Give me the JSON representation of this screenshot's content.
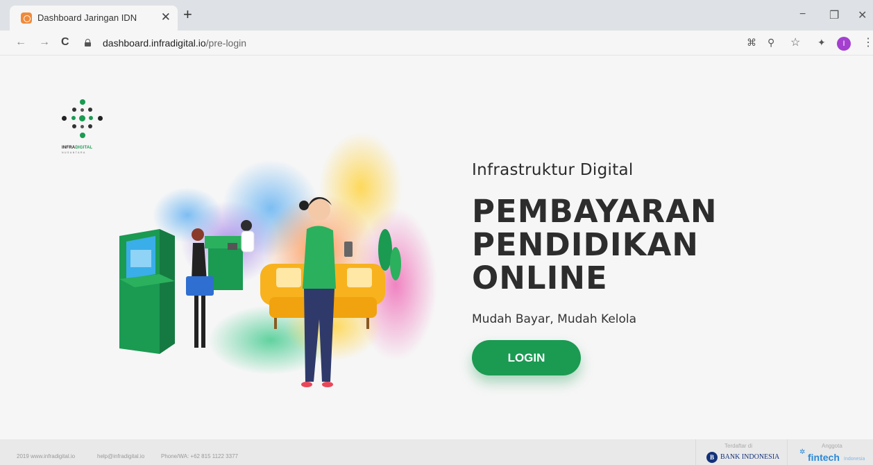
{
  "browser": {
    "tab_title": "Dashboard Jaringan IDN",
    "tab_close": "✕",
    "new_tab": "+",
    "url_host": "dashboard.infradigital.io",
    "url_path": "/pre-login",
    "profile_initial": "I",
    "window_controls": {
      "minimize": "−",
      "restore": "❐",
      "close": "✕"
    },
    "nav": {
      "back": "←",
      "forward": "→",
      "reload": "C"
    },
    "toolbar_icons": {
      "qr": "⌘",
      "zoom": "⚲",
      "star": "☆",
      "extensions": "✦",
      "menu": "⋮"
    }
  },
  "logo": {
    "word_infra": "INFRA",
    "word_digital": "DIGITAL",
    "subtitle": "NUSANTARA"
  },
  "hero": {
    "subtitle": "Infrastruktur Digital",
    "title_lines": [
      "PEMBAYARAN",
      "PENDIDIKAN",
      "ONLINE"
    ],
    "tagline": "Mudah Bayar, Mudah Kelola",
    "login_label": "LOGIN"
  },
  "footer": {
    "site": "2019 www.infradigital.io",
    "email": "help@infradigital.io",
    "phone": "Phone/WA: +62 815 1122 3377",
    "registered_label": "Terdaftar di",
    "bank": "BANK INDONESIA",
    "bank_badge": "B",
    "member_label": "Anggota",
    "fintech": "fintech",
    "fintech_sub": "Indonesia"
  },
  "colors": {
    "brand_green": "#1b9a52",
    "title_dark": "#2d2d2d",
    "page_bg": "#f6f6f6"
  }
}
